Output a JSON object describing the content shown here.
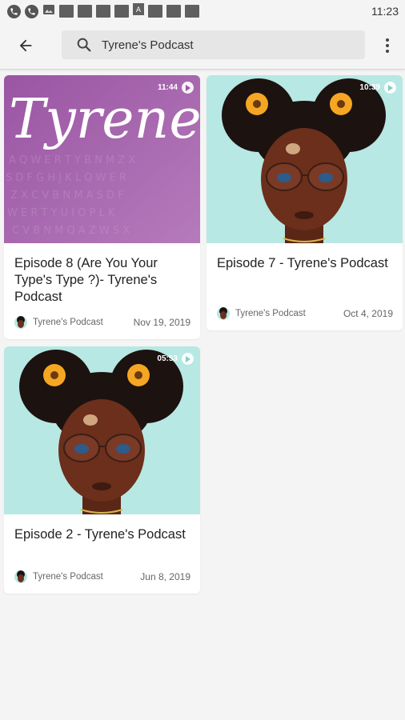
{
  "status_bar": {
    "time": "11:23",
    "icons": [
      "call-icon",
      "call-icon",
      "image-icon",
      "notification-icon",
      "notification-icon",
      "notification-icon",
      "notification-icon",
      "text-icon",
      "notification-icon",
      "notification-icon",
      "notification-icon"
    ]
  },
  "app_bar": {
    "search_value": "Tyrene's Podcast",
    "icons": {
      "back": "arrow-back-icon",
      "search": "search-icon",
      "menu": "more-vert-icon"
    }
  },
  "cards": [
    {
      "cover": "Tyrene",
      "duration": "11:44",
      "title": "Episode 8 (Are You Your Type's Type ?)- Tyrene's Podcast",
      "channel": "Tyrene's Podcast",
      "date": "Nov 19, 2019"
    },
    {
      "duration": "10:39",
      "title": "Episode 7 - Tyrene's Podcast",
      "channel": "Tyrene's Podcast",
      "date": "Oct 4, 2019"
    },
    {
      "duration": "05:53",
      "title": "Episode 2 - Tyrene's Podcast",
      "channel": "Tyrene's Podcast",
      "date": "Jun 8, 2019"
    }
  ],
  "colors": {
    "background": "#f4f4f4",
    "cover_purple": "#a463ac",
    "cover_mint": "#b7e8e3",
    "skin": "#6b2f1c",
    "hair": "#1c1210",
    "flower": "#f5a623"
  }
}
